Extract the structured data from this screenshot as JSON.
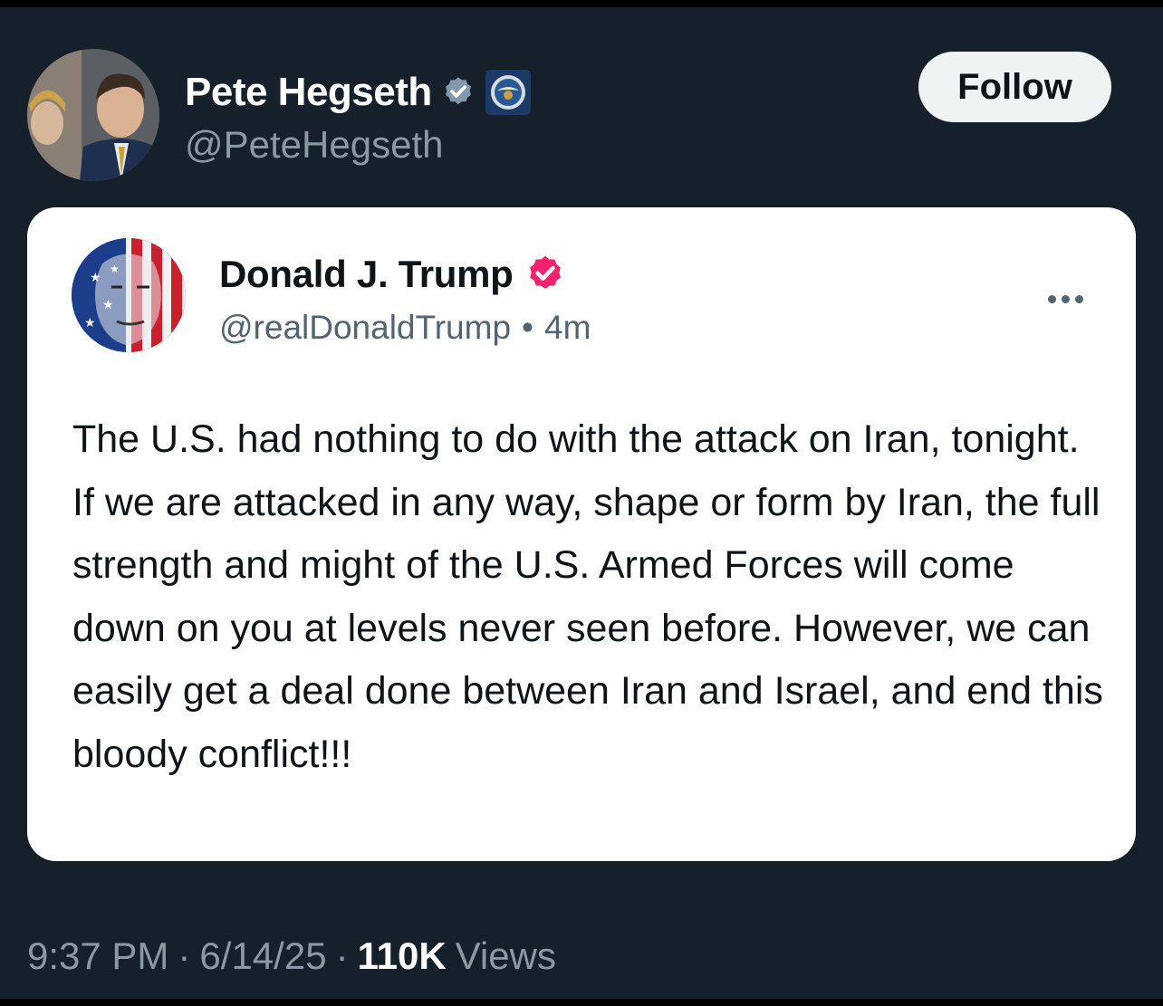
{
  "author": {
    "display_name": "Pete Hegseth",
    "handle": "@PeteHegseth",
    "verified_badge_icon": "verified-badge-icon",
    "verified_badge_color": "#829aab",
    "affiliate_badge_icon": "dod-seal-icon"
  },
  "follow_button": {
    "label": "Follow"
  },
  "quoted_post": {
    "display_name": "Donald J. Trump",
    "handle": "@realDonaldTrump",
    "separator": "•",
    "time_ago": "4m",
    "verified_badge_color": "#f4216e",
    "more_icon": "more-options-icon",
    "text": "The U.S. had nothing to do with the attack on Iran, tonight. If we are attacked in any way, shape or form by Iran, the full strength and might of the U.S. Armed Forces will come down on you at levels never seen before. However, we can easily get a deal done between Iran and Israel, and end this bloody conflict!!!"
  },
  "footer": {
    "time": "9:37 PM",
    "separator": "·",
    "date": "6/14/25",
    "views_count": "110K",
    "views_label": "Views"
  },
  "colors": {
    "background": "#15202b",
    "card": "#ffffff",
    "primary_text_dark": "#ffffff",
    "secondary_text_dark": "#8b98a5",
    "primary_text_light": "#0f1419",
    "secondary_text_light": "#536471"
  }
}
